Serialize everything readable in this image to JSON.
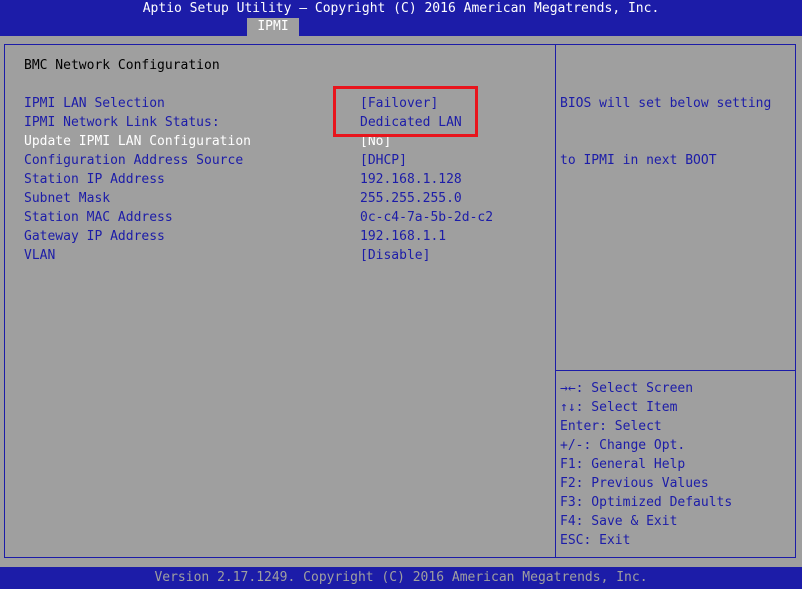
{
  "header": {
    "title": "Aptio Setup Utility – Copyright (C) 2016 American Megatrends, Inc.",
    "tab": "IPMI"
  },
  "main": {
    "section_title": "BMC Network Configuration",
    "rows": [
      {
        "label": "IPMI LAN Selection",
        "value": "[Failover]"
      },
      {
        "label": "IPMI Network Link Status:",
        "value": "Dedicated LAN"
      },
      {
        "label": "Update IPMI LAN Configuration",
        "value": "[No]"
      },
      {
        "label": "Configuration Address Source",
        "value": "[DHCP]"
      },
      {
        "label": "Station IP Address",
        "value": "192.168.1.128"
      },
      {
        "label": "Subnet Mask",
        "value": "255.255.255.0"
      },
      {
        "label": "Station MAC Address",
        "value": "0c-c4-7a-5b-2d-c2"
      },
      {
        "label": "Gateway IP Address",
        "value": "192.168.1.1"
      },
      {
        "label": "VLAN",
        "value": "[Disable]"
      }
    ]
  },
  "help": {
    "description_line1": "BIOS will set below setting",
    "description_line2": "to IPMI in next BOOT",
    "keys": [
      "→←: Select Screen",
      "↑↓: Select Item",
      "Enter: Select",
      "+/-: Change Opt.",
      "F1: General Help",
      "F2: Previous Values",
      "F3: Optimized Defaults",
      "F4: Save & Exit",
      "ESC: Exit"
    ]
  },
  "footer": {
    "text": "Version 2.17.1249. Copyright (C) 2016 American Megatrends, Inc."
  },
  "colors": {
    "background": "#9f9f9f",
    "header_blue": "#1c1ca8",
    "highlight_red": "#e8141c",
    "text_black": "#000000",
    "text_white": "#ffffff"
  }
}
